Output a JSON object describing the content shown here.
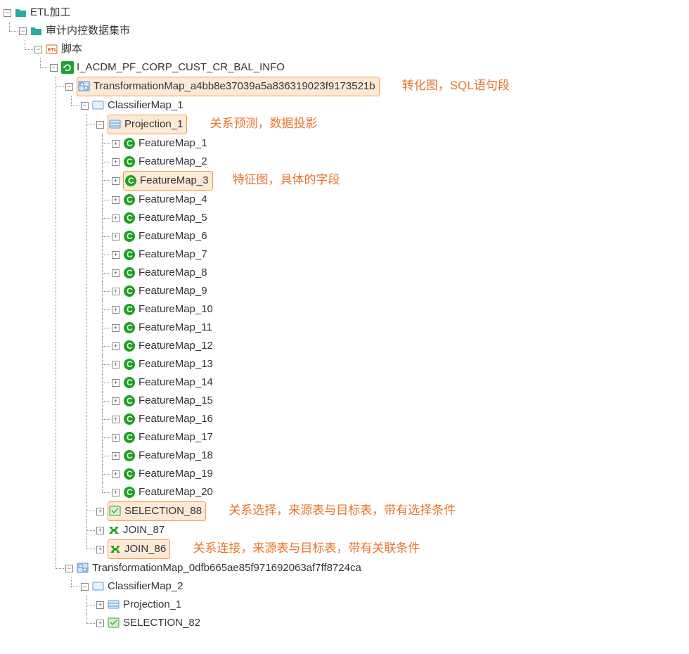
{
  "tree": {
    "root": {
      "label": "ETL加工",
      "children": {
        "mart": {
          "label": "审计内控数据集市",
          "children": {
            "script": {
              "label": "脚本",
              "children": {
                "job": {
                  "label": "I_ACDM_PF_CORP_CUST_CR_BAL_INFO",
                  "tmap1": {
                    "label": "TransformationMap_a4bb8e37039a5a836319023f9173521b",
                    "annotation": "转化图，SQL语句段",
                    "classifier": {
                      "label": "ClassifierMap_1",
                      "projection": {
                        "label": "Projection_1",
                        "annotation": "关系预测，数据投影",
                        "features": [
                          "FeatureMap_1",
                          "FeatureMap_2",
                          "FeatureMap_3",
                          "FeatureMap_4",
                          "FeatureMap_5",
                          "FeatureMap_6",
                          "FeatureMap_7",
                          "FeatureMap_8",
                          "FeatureMap_9",
                          "FeatureMap_10",
                          "FeatureMap_11",
                          "FeatureMap_12",
                          "FeatureMap_13",
                          "FeatureMap_14",
                          "FeatureMap_15",
                          "FeatureMap_16",
                          "FeatureMap_17",
                          "FeatureMap_18",
                          "FeatureMap_19",
                          "FeatureMap_20"
                        ],
                        "feature_annotation_index": 2,
                        "feature_annotation": "特征图，具体的字段"
                      },
                      "selection": {
                        "label": "SELECTION_88",
                        "annotation": "关系选择，来源表与目标表，带有选择条件"
                      },
                      "join87": {
                        "label": "JOIN_87"
                      },
                      "join86": {
                        "label": "JOIN_86",
                        "annotation": "关系连接，来源表与目标表，带有关联条件"
                      }
                    }
                  },
                  "tmap2": {
                    "label": "TransformationMap_0dfb665ae85f971692063af7ff8724ca",
                    "classifier": {
                      "label": "ClassifierMap_2",
                      "projection": {
                        "label": "Projection_1"
                      },
                      "selection": {
                        "label": "SELECTION_82"
                      }
                    }
                  }
                }
              }
            }
          }
        }
      }
    }
  },
  "glyph": {
    "minus": "−",
    "plus": "+"
  }
}
